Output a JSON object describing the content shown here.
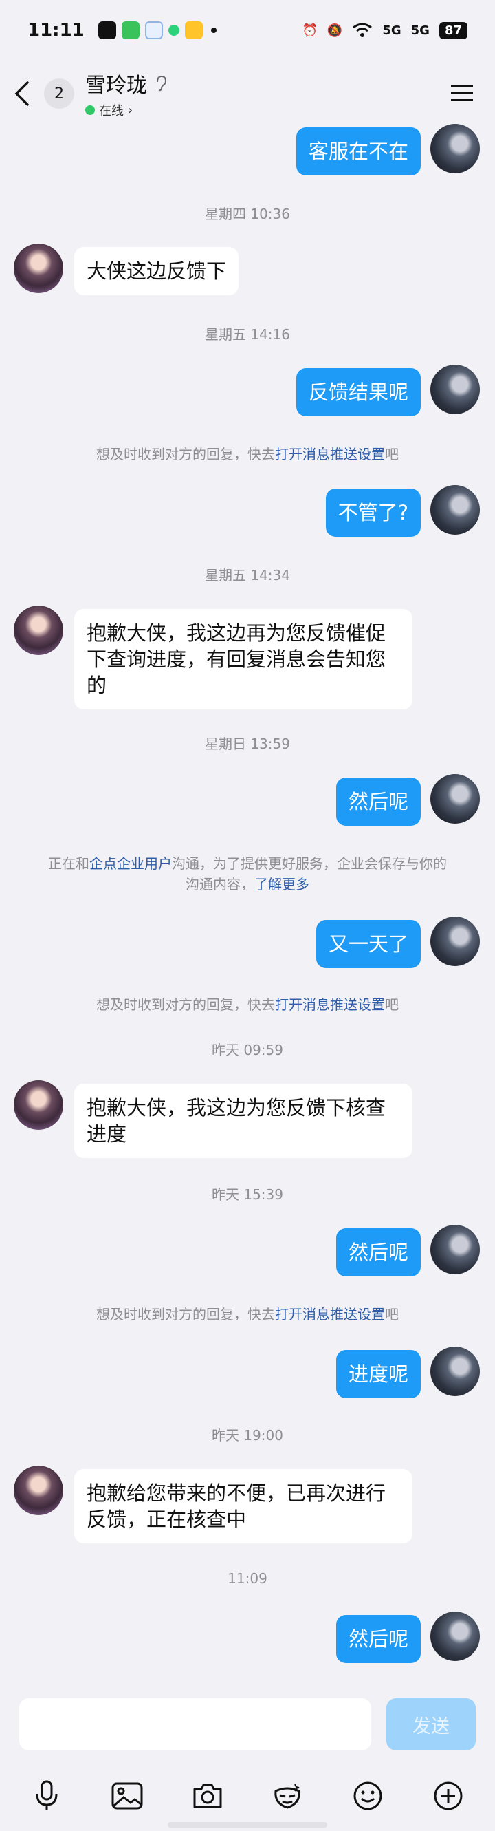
{
  "status_bar": {
    "time": "11:11",
    "signal1": "5G",
    "signal2": "5G",
    "battery": "87"
  },
  "header": {
    "unread_count": "2",
    "title": "雪玲珑",
    "status_text": "在线"
  },
  "messages": [
    {
      "type": "me",
      "text": "客服在不在"
    },
    {
      "type": "time",
      "text": "星期四 10:36"
    },
    {
      "type": "cs",
      "text": "大侠这边反馈下"
    },
    {
      "type": "time",
      "text": "星期五 14:16"
    },
    {
      "type": "me",
      "text": "反馈结果呢"
    },
    {
      "type": "system",
      "pre": "想及时收到对方的回复，快去",
      "link": "打开消息推送设置",
      "post": "吧"
    },
    {
      "type": "me",
      "text": "不管了?"
    },
    {
      "type": "time",
      "text": "星期五 14:34"
    },
    {
      "type": "cs",
      "line1": "抱歉大侠，我这边再为您反馈催促",
      "line2": "下查询进度，有回复消息会告知您",
      "line3": "的"
    },
    {
      "type": "time",
      "text": "星期日 13:59"
    },
    {
      "type": "me",
      "text": "然后呢"
    },
    {
      "type": "system",
      "pre": "正在和",
      "link": "企点企业用户",
      "mid": "沟通，为了提供更好服务，企业会保存与你的",
      "line2_pre": "沟通内容，",
      "link2": "了解更多"
    },
    {
      "type": "me",
      "text": "又一天了"
    },
    {
      "type": "system",
      "pre": "想及时收到对方的回复，快去",
      "link": "打开消息推送设置",
      "post": "吧"
    },
    {
      "type": "time",
      "text": "昨天 09:59"
    },
    {
      "type": "cs",
      "line1": "抱歉大侠，我这边为您反馈下核查",
      "line2": "进度"
    },
    {
      "type": "time",
      "text": "昨天 15:39"
    },
    {
      "type": "me",
      "text": "然后呢"
    },
    {
      "type": "system",
      "pre": "想及时收到对方的回复，快去",
      "link": "打开消息推送设置",
      "post": "吧"
    },
    {
      "type": "me",
      "text": "进度呢"
    },
    {
      "type": "time",
      "text": "昨天 19:00"
    },
    {
      "type": "cs",
      "line1": "抱歉给您带来的不便，已再次进行",
      "line2": "反馈，正在核查中"
    },
    {
      "type": "time",
      "text": "11:09"
    },
    {
      "type": "me",
      "text": "然后呢"
    }
  ],
  "input": {
    "placeholder": "",
    "send_label": "发送"
  },
  "colors": {
    "bubble_me": "#1d9bf6",
    "bubble_cs": "#ffffff",
    "link": "#2d5ca8",
    "online": "#2ec866"
  },
  "icons": [
    "mic-icon",
    "image-icon",
    "camera-icon",
    "sticker-icon",
    "emoji-icon",
    "plus-icon"
  ]
}
